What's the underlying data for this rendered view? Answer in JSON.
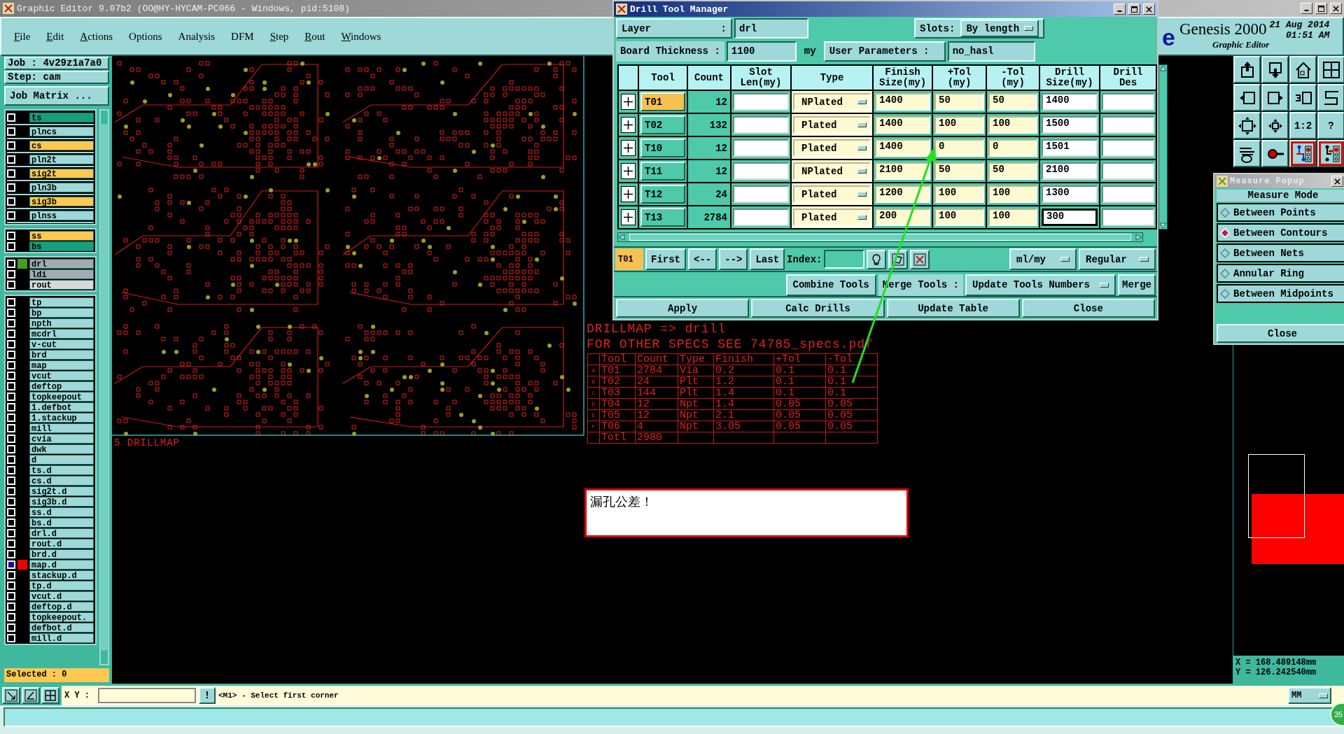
{
  "window": {
    "title": "Graphic Editor 9.07b2 (OO@HY-HYCAM-PC066 - Windows, pid:5108)"
  },
  "menu": [
    {
      "label": "File",
      "underlined": true
    },
    {
      "label": "Edit",
      "underlined": true
    },
    {
      "label": "Actions",
      "underlined": true
    },
    {
      "label": "Options",
      "underlined": false
    },
    {
      "label": "Analysis",
      "underlined": false
    },
    {
      "label": "DFM",
      "underlined": false
    },
    {
      "label": "Step",
      "underlined": true
    },
    {
      "label": "Rout",
      "underlined": true
    },
    {
      "label": "Windows",
      "underlined": true
    }
  ],
  "brand": {
    "fragment": "e",
    "product": "Genesis 2000",
    "subtitle": "Graphic Editor",
    "date": "21 Aug 2014",
    "time": "01:51 AM"
  },
  "job": {
    "job": "Job : 4v29z1a7a0",
    "step": "Step: cam",
    "matrix_button": "Job Matrix ..."
  },
  "layer_groups": [
    {
      "layers": [
        {
          "name": "ts",
          "color": "#12a07e",
          "selected": false
        },
        {
          "name": "plncs",
          "color": "#9ed8d8",
          "selected": false
        },
        {
          "name": "cs",
          "color": "#ffc850",
          "selected": false
        },
        {
          "name": "pln2t",
          "color": "#9ed8d8",
          "selected": false
        },
        {
          "name": "sig2t",
          "color": "#ffc850",
          "selected": false
        },
        {
          "name": "pln3b",
          "color": "#9ed8d8",
          "selected": false
        },
        {
          "name": "sig3b",
          "color": "#ffc850",
          "selected": false
        },
        {
          "name": "plnss",
          "color": "#9ed8d8",
          "selected": false
        }
      ]
    },
    {
      "layers": [
        {
          "name": "ss",
          "color": "#ffc850",
          "selected": false
        },
        {
          "name": "bs",
          "color": "#12a07e",
          "selected": false
        }
      ]
    },
    {
      "layers": [
        {
          "name": "drl",
          "color": "#a0acb4",
          "swatch": {
            "color": "#40a020"
          },
          "selected": false
        },
        {
          "name": "ldi",
          "color": "#a0acb4",
          "selected": false
        },
        {
          "name": "rout",
          "color": "#d8d8d8",
          "selected": false
        }
      ]
    },
    {
      "layers": [
        {
          "name": "tp",
          "color": "#9ed8d8",
          "selected": false
        },
        {
          "name": "bp",
          "color": "#9ed8d8",
          "selected": false
        },
        {
          "name": "npth",
          "color": "#9ed8d8",
          "selected": false
        },
        {
          "name": "mcdrl",
          "color": "#9ed8d8",
          "selected": false
        },
        {
          "name": "v-cut",
          "color": "#9ed8d8",
          "selected": false
        },
        {
          "name": "brd",
          "color": "#9ed8d8",
          "selected": false
        },
        {
          "name": "map",
          "color": "#9ed8d8",
          "selected": false
        },
        {
          "name": "vcut",
          "color": "#9ed8d8",
          "selected": false
        },
        {
          "name": "deftop",
          "color": "#9ed8d8",
          "selected": false
        },
        {
          "name": "topkeepout",
          "color": "#9ed8d8",
          "selected": false
        },
        {
          "name": "1.defbot",
          "color": "#9ed8d8",
          "selected": false
        },
        {
          "name": "1.stackup",
          "color": "#9ed8d8",
          "selected": false
        },
        {
          "name": "mill",
          "color": "#9ed8d8",
          "selected": false
        },
        {
          "name": "cvia",
          "color": "#9ed8d8",
          "selected": false
        },
        {
          "name": "dwk",
          "color": "#9ed8d8",
          "selected": false
        },
        {
          "name": "d",
          "color": "#9ed8d8",
          "selected": false
        },
        {
          "name": "ts.d",
          "color": "#9ed8d8",
          "selected": false
        },
        {
          "name": "cs.d",
          "color": "#9ed8d8",
          "selected": false
        },
        {
          "name": "sig2t.d",
          "color": "#9ed8d8",
          "selected": false
        },
        {
          "name": "sig3b.d",
          "color": "#9ed8d8",
          "selected": false
        },
        {
          "name": "ss.d",
          "color": "#9ed8d8",
          "selected": false
        },
        {
          "name": "bs.d",
          "color": "#9ed8d8",
          "selected": false
        },
        {
          "name": "drl.d",
          "color": "#9ed8d8",
          "selected": false
        },
        {
          "name": "rout.d",
          "color": "#9ed8d8",
          "selected": false
        },
        {
          "name": "brd.d",
          "color": "#9ed8d8",
          "selected": false
        },
        {
          "name": "map.d",
          "color": "#9ed8d8",
          "swatch": {
            "color": "#f00000"
          },
          "selected": true
        },
        {
          "name": "stackup.d",
          "color": "#9ed8d8",
          "selected": false
        },
        {
          "name": "tp.d",
          "color": "#9ed8d8",
          "selected": false
        },
        {
          "name": "vcut.d",
          "color": "#9ed8d8",
          "selected": false
        },
        {
          "name": "deftop.d",
          "color": "#9ed8d8",
          "selected": false
        },
        {
          "name": "topkeepout.",
          "color": "#9ed8d8",
          "selected": false
        },
        {
          "name": "defbot.d",
          "color": "#9ed8d8",
          "selected": false
        },
        {
          "name": "mill.d",
          "color": "#9ed8d8",
          "selected": false
        }
      ]
    }
  ],
  "selected_count": "Selected : 0",
  "canvas": {
    "drillmap_label": "5  DRILLMAP",
    "notes": [
      "DRILLMAP => drill",
      "FOR OTHER SPECS SEE 74785_specs.pdf"
    ],
    "drill_table": {
      "columns": [
        "",
        "Tool",
        "Count",
        "Type",
        "Finish",
        "+Tol",
        "-Tol"
      ],
      "rows": [
        [
          "A",
          "T01",
          "2784",
          "Via",
          "0.2",
          "0.1",
          "0.1"
        ],
        [
          "B",
          "T02",
          "24",
          "Plt",
          "1.2",
          "0.1",
          "0.1"
        ],
        [
          "C",
          "T03",
          "144",
          "Plt",
          "1.4",
          "0.1",
          "0.1"
        ],
        [
          "D",
          "T04",
          "12",
          "Npt",
          "1.4",
          "0.05",
          "0.05"
        ],
        [
          "E",
          "T05",
          "12",
          "Npt",
          "2.1",
          "0.05",
          "0.05"
        ],
        [
          "F",
          "T06",
          "4",
          "Npt",
          "3.05",
          "0.05",
          "0.05"
        ],
        [
          "",
          "Totl",
          "2980",
          "",
          "",
          "",
          ""
        ]
      ]
    },
    "annotation": "漏孔公差！",
    "coordinates": [
      "X = 168.489148mm",
      "Y = 126.242540mm"
    ]
  },
  "toolbar": [
    {
      "kind": "icon",
      "active": false
    },
    {
      "kind": "icon",
      "active": false
    },
    {
      "kind": "icon",
      "active": false
    },
    {
      "kind": "icon",
      "active": false
    },
    {
      "kind": "icon",
      "active": false
    },
    {
      "kind": "icon",
      "active": false
    },
    {
      "kind": "icon",
      "active": false
    },
    {
      "kind": "icon",
      "active": false
    },
    {
      "kind": "icon",
      "active": false
    },
    {
      "kind": "icon",
      "active": false
    },
    {
      "kind": "text",
      "label": "1:2",
      "active": false
    },
    {
      "kind": "text",
      "label": "?",
      "active": false
    },
    {
      "kind": "icon",
      "active": false
    },
    {
      "kind": "icon",
      "active": false
    },
    {
      "kind": "icon",
      "active": true
    },
    {
      "kind": "icon",
      "active": true
    }
  ],
  "drill_tool_manager": {
    "title": "Drill Tool Manager",
    "layer_label": "Layer",
    "layer_colon": ":",
    "layer": "drl",
    "slots_label": "Slots:",
    "slots": "By length",
    "thickness_label": "Board Thickness :",
    "thickness": "1100",
    "thickness_unit": "my",
    "user_params_button": "User Parameters :",
    "user_params": "no_hasl",
    "columns": [
      "Tool",
      "Count",
      "Slot Len(my)",
      "Type",
      "Finish Size(my)",
      "+Tol (my)",
      "-Tol (my)",
      "Drill Size(my)",
      "Drill Des"
    ],
    "tools": [
      {
        "tool": "T01",
        "selected": true,
        "count": "12",
        "type": "NPlated",
        "finish": "1400",
        "plus_tol": "50",
        "minus_tol": "50",
        "drill": "1400",
        "focused": false
      },
      {
        "tool": "T02",
        "selected": false,
        "count": "132",
        "type": "Plated",
        "finish": "1400",
        "plus_tol": "100",
        "minus_tol": "100",
        "drill": "1500",
        "focused": false
      },
      {
        "tool": "T10",
        "selected": false,
        "count": "12",
        "type": "Plated",
        "finish": "1400",
        "plus_tol": "0",
        "minus_tol": "0",
        "drill": "1501",
        "focused": false
      },
      {
        "tool": "T11",
        "selected": false,
        "count": "12",
        "type": "NPlated",
        "finish": "2100",
        "plus_tol": "50",
        "minus_tol": "50",
        "drill": "2100",
        "focused": false
      },
      {
        "tool": "T12",
        "selected": false,
        "count": "24",
        "type": "Plated",
        "finish": "1200",
        "plus_tol": "100",
        "minus_tol": "100",
        "drill": "1300",
        "focused": false
      },
      {
        "tool": "T13",
        "selected": false,
        "count": "2784",
        "type": "Plated",
        "finish": "200",
        "plus_tol": "100",
        "minus_tol": "100",
        "drill": "300",
        "focused": true
      }
    ],
    "current_tool": "T01",
    "nav": [
      "First",
      "<--",
      "-->",
      "Last"
    ],
    "index_label": "Index:",
    "units": "ml/my",
    "mode": "Regular",
    "combine": "Combine Tools",
    "merge_label": "Merge Tools :",
    "merge_option": "Update Tools Numbers",
    "merge": "Merge",
    "actions": [
      "Apply",
      "Calc Drills",
      "Update Table",
      "Close"
    ]
  },
  "measure_popup": {
    "title": "Measure Popup",
    "heading": "Measure Mode",
    "modes": [
      {
        "label": "Between Points",
        "selected": false
      },
      {
        "label": "Between Contours",
        "selected": true
      },
      {
        "label": "Between Nets",
        "selected": false
      },
      {
        "label": "Annular Ring",
        "selected": false
      },
      {
        "label": "Between Midpoints",
        "selected": false
      }
    ],
    "close": "Close"
  },
  "bottom_bar": {
    "xy_label": "X Y :",
    "alert_button": "!",
    "message": "<M1> - Select first corner",
    "units": "MM",
    "badge": "35"
  }
}
